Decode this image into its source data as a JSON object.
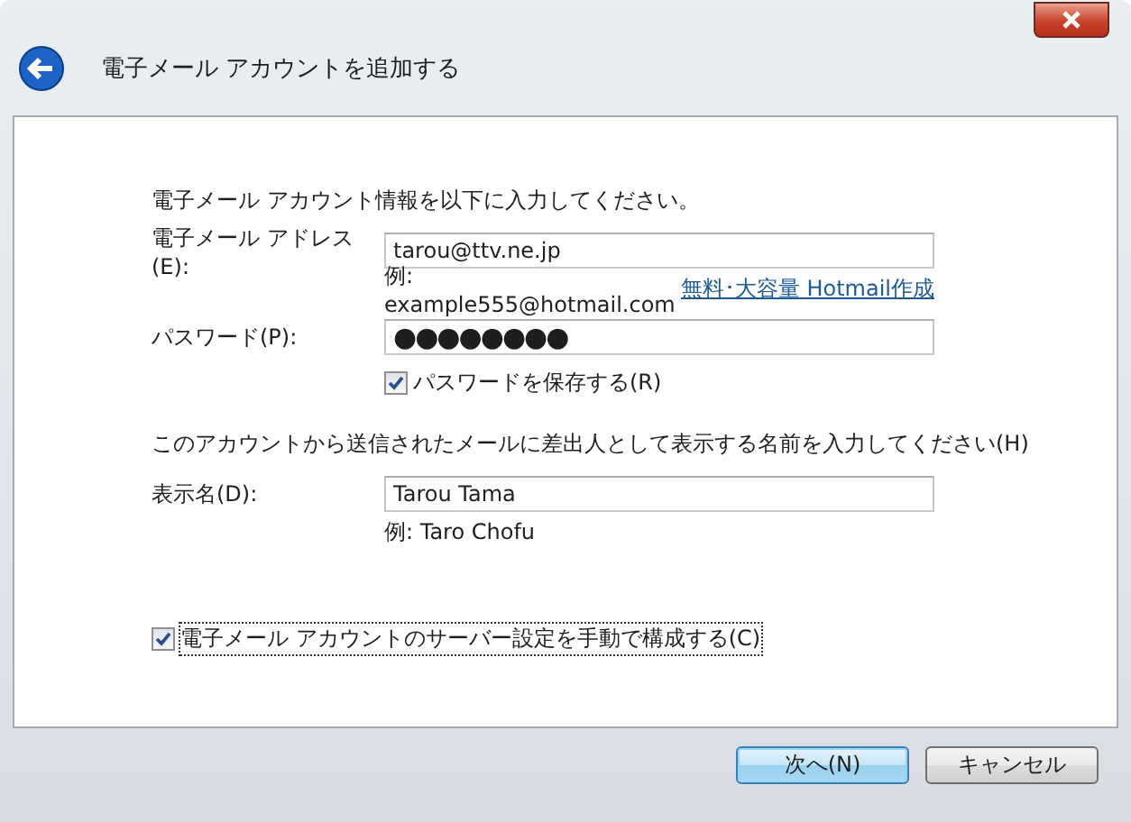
{
  "window": {
    "title": "電子メール アカウントを追加する"
  },
  "instruction": "電子メール アカウント情報を以下に入力してください。",
  "email": {
    "label": "電子メール アドレス(E):",
    "value": "tarou@ttv.ne.jp",
    "example": "例: example555@hotmail.com",
    "link": "無料･大容量 Hotmail作成"
  },
  "password": {
    "label": "パスワード(P):",
    "value": "●●●●●●●●"
  },
  "save_password": {
    "label": "パスワードを保存する(R)",
    "checked": true
  },
  "display_name_prompt": "このアカウントから送信されたメールに差出人として表示する名前を入力してください(H)",
  "display_name": {
    "label": "表示名(D):",
    "value": "Tarou Tama",
    "example": "例: Taro Chofu"
  },
  "manual_setup": {
    "label": "電子メール アカウントのサーバー設定を手動で構成する(C)",
    "checked": true,
    "focused": true
  },
  "buttons": [
    {
      "label": "次へ(N)",
      "kind": "default"
    },
    {
      "label": "キャンセル",
      "kind": "normal"
    }
  ]
}
